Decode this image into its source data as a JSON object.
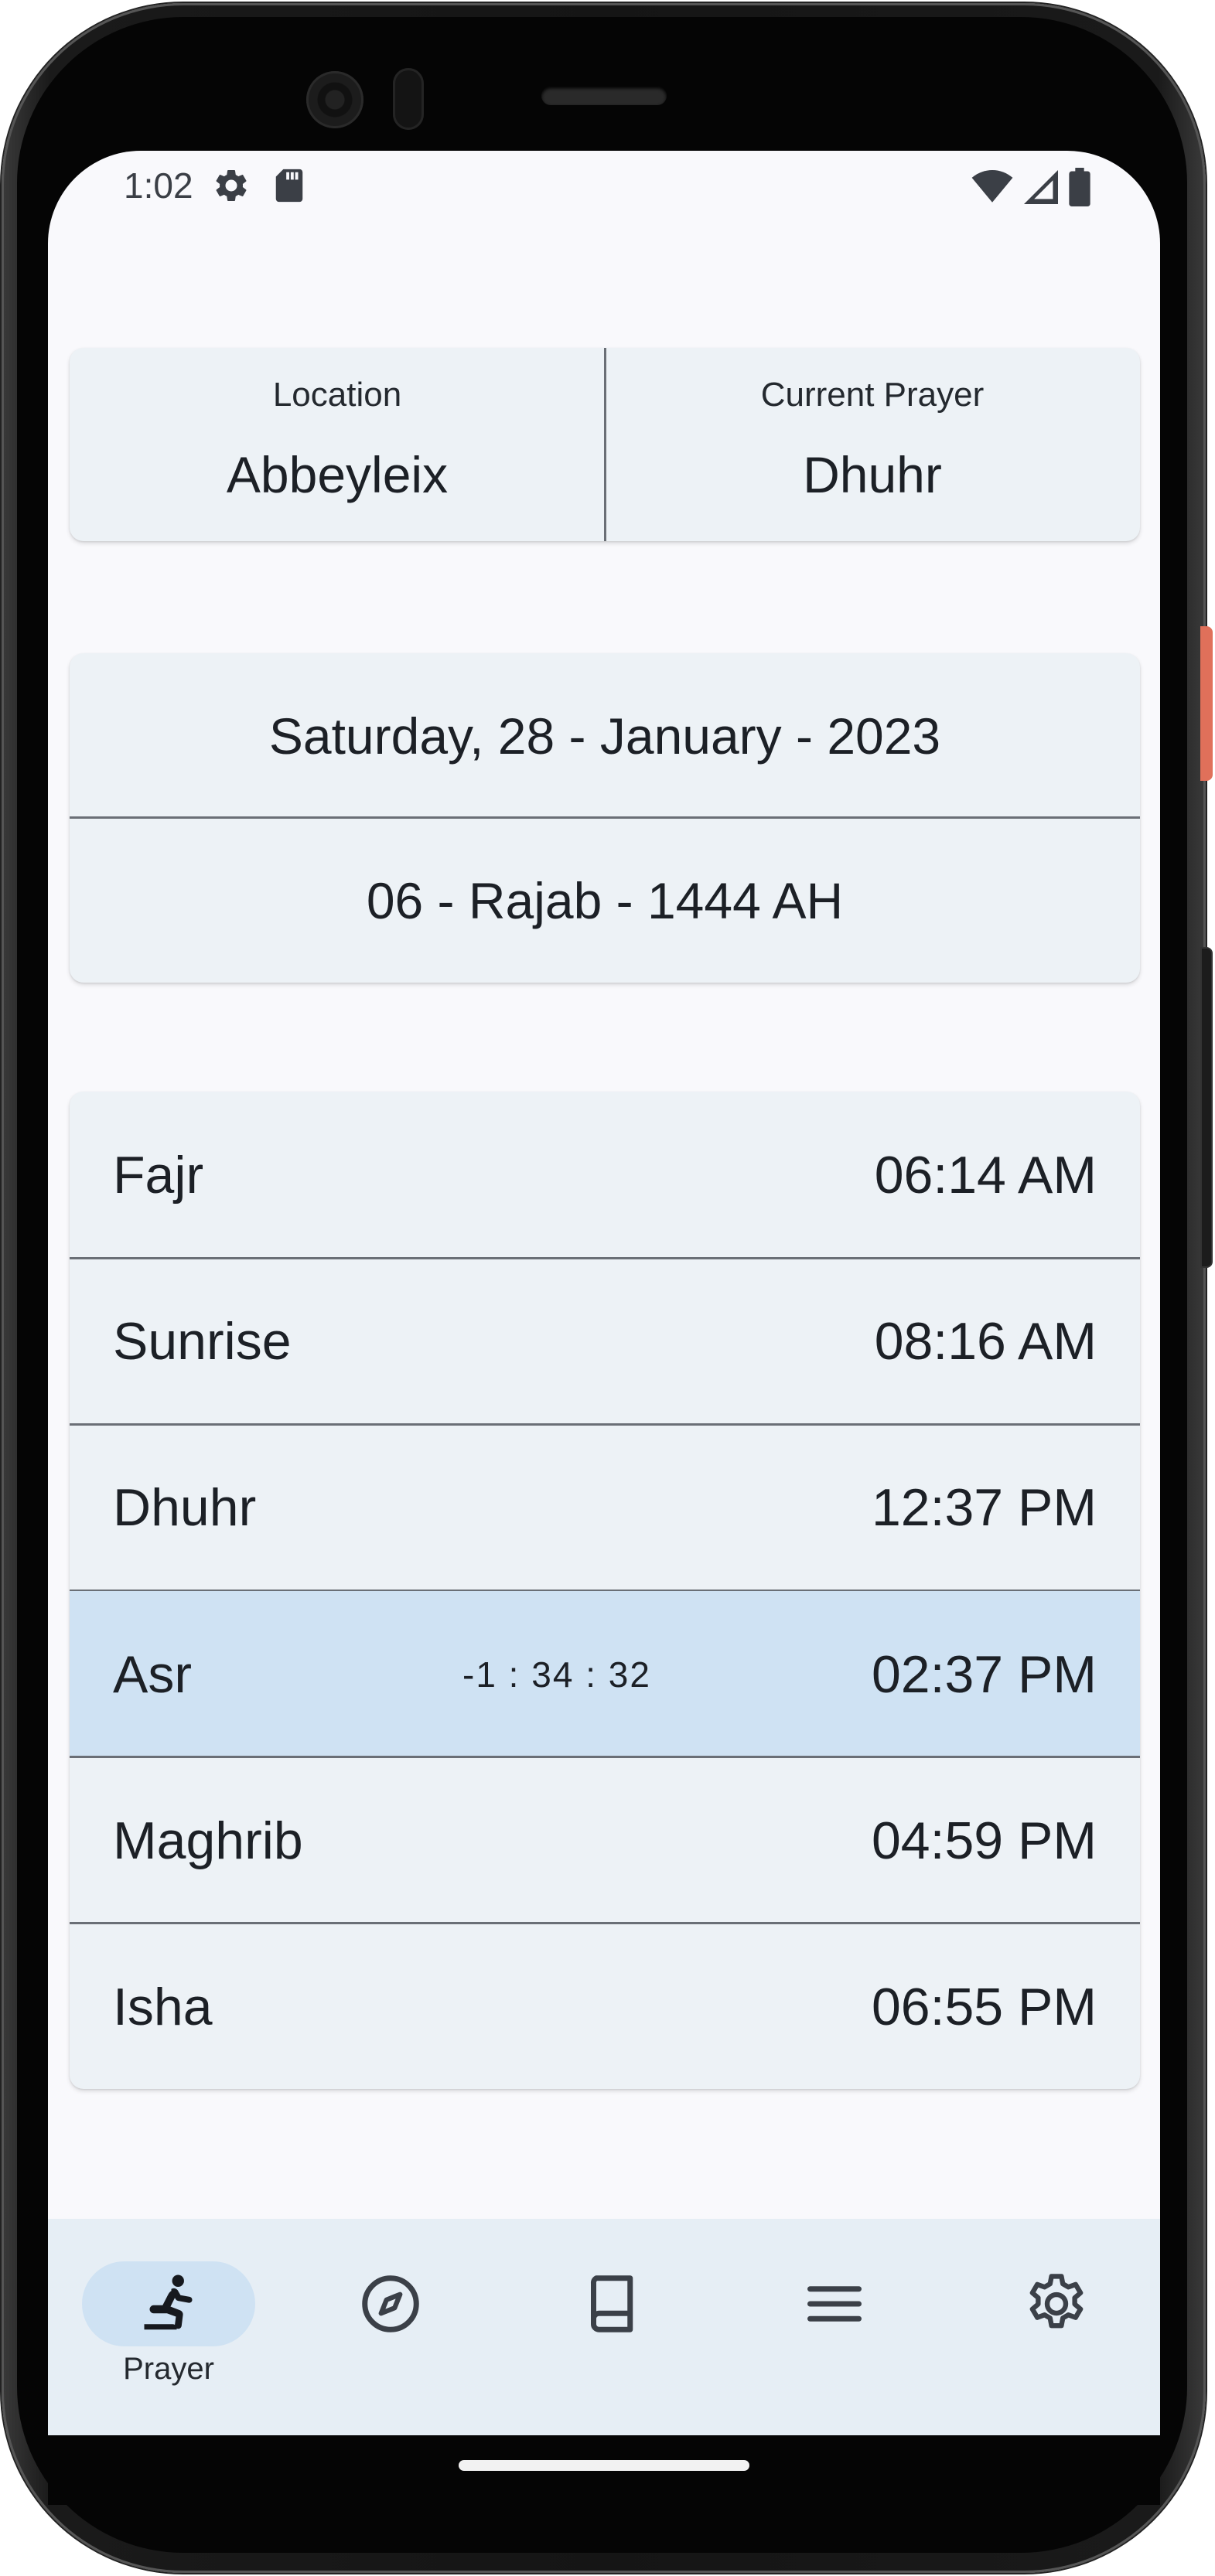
{
  "status_bar": {
    "time": "1:02",
    "left_icons": [
      "settings-gear-icon",
      "sd-card-icon"
    ],
    "right_icons": [
      "wifi-icon",
      "cellular-signal-icon",
      "battery-icon"
    ]
  },
  "info_card": {
    "location_label": "Location",
    "location_value": "Abbeyleix",
    "current_prayer_label": "Current Prayer",
    "current_prayer_value": "Dhuhr"
  },
  "date_card": {
    "gregorian": "Saturday, 28 - January - 2023",
    "hijri": "06 - Rajab - 1444 AH"
  },
  "prayers": [
    {
      "name": "Fajr",
      "time": "06:14 AM",
      "countdown": ""
    },
    {
      "name": "Sunrise",
      "time": "08:16 AM",
      "countdown": ""
    },
    {
      "name": "Dhuhr",
      "time": "12:37 PM",
      "countdown": ""
    },
    {
      "name": "Asr",
      "time": "02:37 PM",
      "countdown": "-1 : 34 : 32",
      "active": true
    },
    {
      "name": "Maghrib",
      "time": "04:59 PM",
      "countdown": ""
    },
    {
      "name": "Isha",
      "time": "06:55 PM",
      "countdown": ""
    }
  ],
  "bottom_nav": {
    "items": [
      {
        "icon": "praying-person-icon",
        "label": "Prayer",
        "selected": true
      },
      {
        "icon": "compass-icon",
        "label": ""
      },
      {
        "icon": "book-icon",
        "label": ""
      },
      {
        "icon": "menu-icon",
        "label": ""
      },
      {
        "icon": "settings-icon",
        "label": ""
      }
    ]
  },
  "colors": {
    "screen_bg": "#f9f9fc",
    "card_bg": "#edf2f6",
    "active_row_bg": "#cfe2f3",
    "nav_bg": "#e6eef5",
    "text": "#1c2026",
    "divider": "#6a6f76"
  }
}
